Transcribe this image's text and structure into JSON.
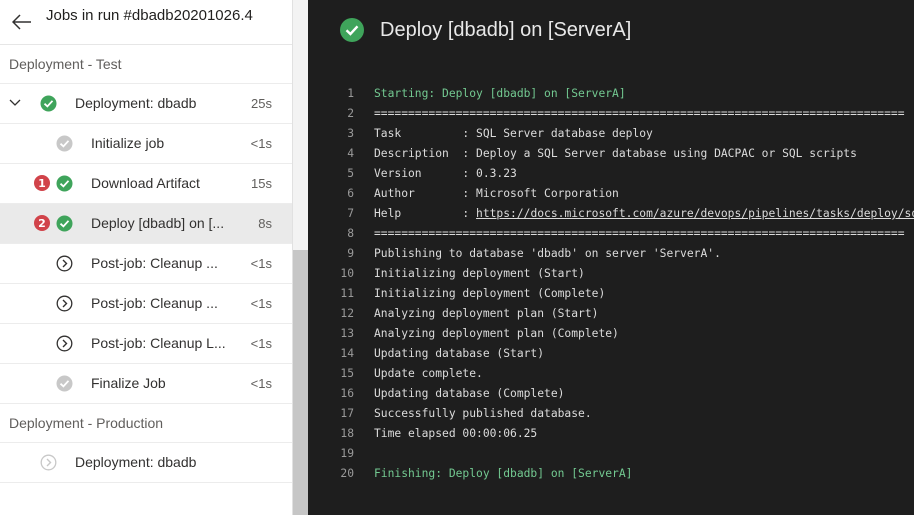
{
  "sidebar": {
    "title": "Jobs in run #dbadb20201026.4",
    "stage_test": "Deployment - Test",
    "stage_prod": "Deployment - Production",
    "job_test": {
      "label": "Deployment: dbadb",
      "duration": "25s"
    },
    "steps": [
      {
        "label": "Initialize job",
        "duration": "<1s",
        "status": "done-gray",
        "badge": ""
      },
      {
        "label": "Download Artifact",
        "duration": "15s",
        "status": "success",
        "badge": "1"
      },
      {
        "label": "Deploy [dbadb] on [...",
        "duration": "8s",
        "status": "success",
        "badge": "2"
      },
      {
        "label": "Post-job: Cleanup ...",
        "duration": "<1s",
        "status": "pending",
        "badge": ""
      },
      {
        "label": "Post-job: Cleanup ...",
        "duration": "<1s",
        "status": "pending",
        "badge": ""
      },
      {
        "label": "Post-job: Cleanup L...",
        "duration": "<1s",
        "status": "pending",
        "badge": ""
      },
      {
        "label": "Finalize Job",
        "duration": "<1s",
        "status": "done-gray",
        "badge": ""
      }
    ],
    "job_prod": {
      "label": "Deployment: dbadb"
    }
  },
  "log": {
    "title": "Deploy [dbadb] on [ServerA]",
    "lines": [
      {
        "n": "1",
        "text": "Starting: Deploy [dbadb] on [ServerA]",
        "style": "green"
      },
      {
        "n": "2",
        "text": "==============================================================================",
        "style": ""
      },
      {
        "n": "3",
        "text": "Task         : SQL Server database deploy",
        "style": ""
      },
      {
        "n": "4",
        "text": "Description  : Deploy a SQL Server database using DACPAC or SQL scripts",
        "style": ""
      },
      {
        "n": "5",
        "text": "Version      : 0.3.23",
        "style": ""
      },
      {
        "n": "6",
        "text": "Author       : Microsoft Corporation",
        "style": ""
      },
      {
        "n": "7",
        "text": "Help         : ",
        "link": "https://docs.microsoft.com/azure/devops/pipelines/tasks/deploy/sql-",
        "style": ""
      },
      {
        "n": "8",
        "text": "==============================================================================",
        "style": ""
      },
      {
        "n": "9",
        "text": "Publishing to database 'dbadb' on server 'ServerA'.",
        "style": ""
      },
      {
        "n": "10",
        "text": "Initializing deployment (Start)",
        "style": ""
      },
      {
        "n": "11",
        "text": "Initializing deployment (Complete)",
        "style": ""
      },
      {
        "n": "12",
        "text": "Analyzing deployment plan (Start)",
        "style": ""
      },
      {
        "n": "13",
        "text": "Analyzing deployment plan (Complete)",
        "style": ""
      },
      {
        "n": "14",
        "text": "Updating database (Start)",
        "style": ""
      },
      {
        "n": "15",
        "text": "Update complete.",
        "style": ""
      },
      {
        "n": "16",
        "text": "Updating database (Complete)",
        "style": ""
      },
      {
        "n": "17",
        "text": "Successfully published database.",
        "style": ""
      },
      {
        "n": "18",
        "text": "Time elapsed 00:00:06.25",
        "style": ""
      },
      {
        "n": "19",
        "text": "",
        "style": ""
      },
      {
        "n": "20",
        "text": "Finishing: Deploy [dbadb] on [ServerA]",
        "style": "green"
      }
    ]
  },
  "colors": {
    "success": "#3fa45b",
    "done_gray": "#c8c8c8",
    "error_badge": "#d1434a",
    "log_green": "#73c991"
  }
}
